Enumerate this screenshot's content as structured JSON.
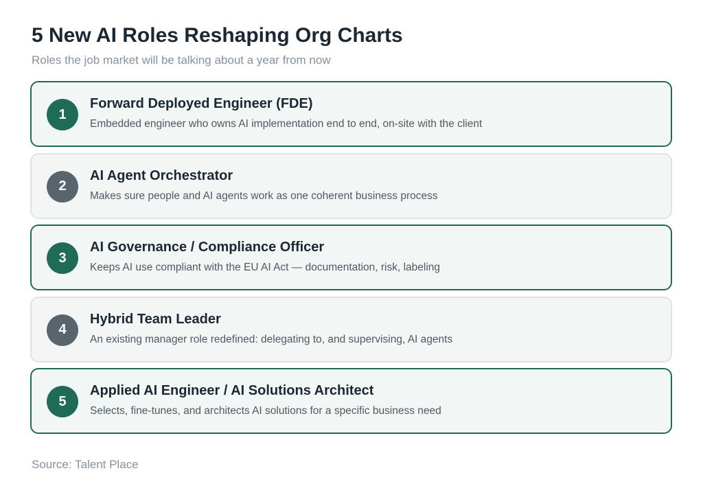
{
  "header": {
    "title": "5 New AI Roles Reshaping Org Charts",
    "subtitle": "Roles the job market will be talking about a year from now"
  },
  "colors": {
    "accent": "#1f6b55",
    "neutral": "#5a646c"
  },
  "roles": [
    {
      "number": "1",
      "title": "Forward Deployed Engineer (FDE)",
      "description": "Embedded engineer who owns AI implementation end to end, on-site with the client",
      "style": "accent"
    },
    {
      "number": "2",
      "title": "AI Agent Orchestrator",
      "description": "Makes sure people and AI agents work as one coherent business process",
      "style": "neutral"
    },
    {
      "number": "3",
      "title": "AI Governance / Compliance Officer",
      "description": "Keeps AI use compliant with the EU AI Act — documentation, risk, labeling",
      "style": "accent"
    },
    {
      "number": "4",
      "title": "Hybrid Team Leader",
      "description": "An existing manager role redefined: delegating to, and supervising, AI agents",
      "style": "neutral"
    },
    {
      "number": "5",
      "title": "Applied AI Engineer / AI Solutions Architect",
      "description": "Selects, fine-tunes, and architects AI solutions for a specific business need",
      "style": "accent"
    }
  ],
  "footer": {
    "source": "Source: Talent Place"
  }
}
